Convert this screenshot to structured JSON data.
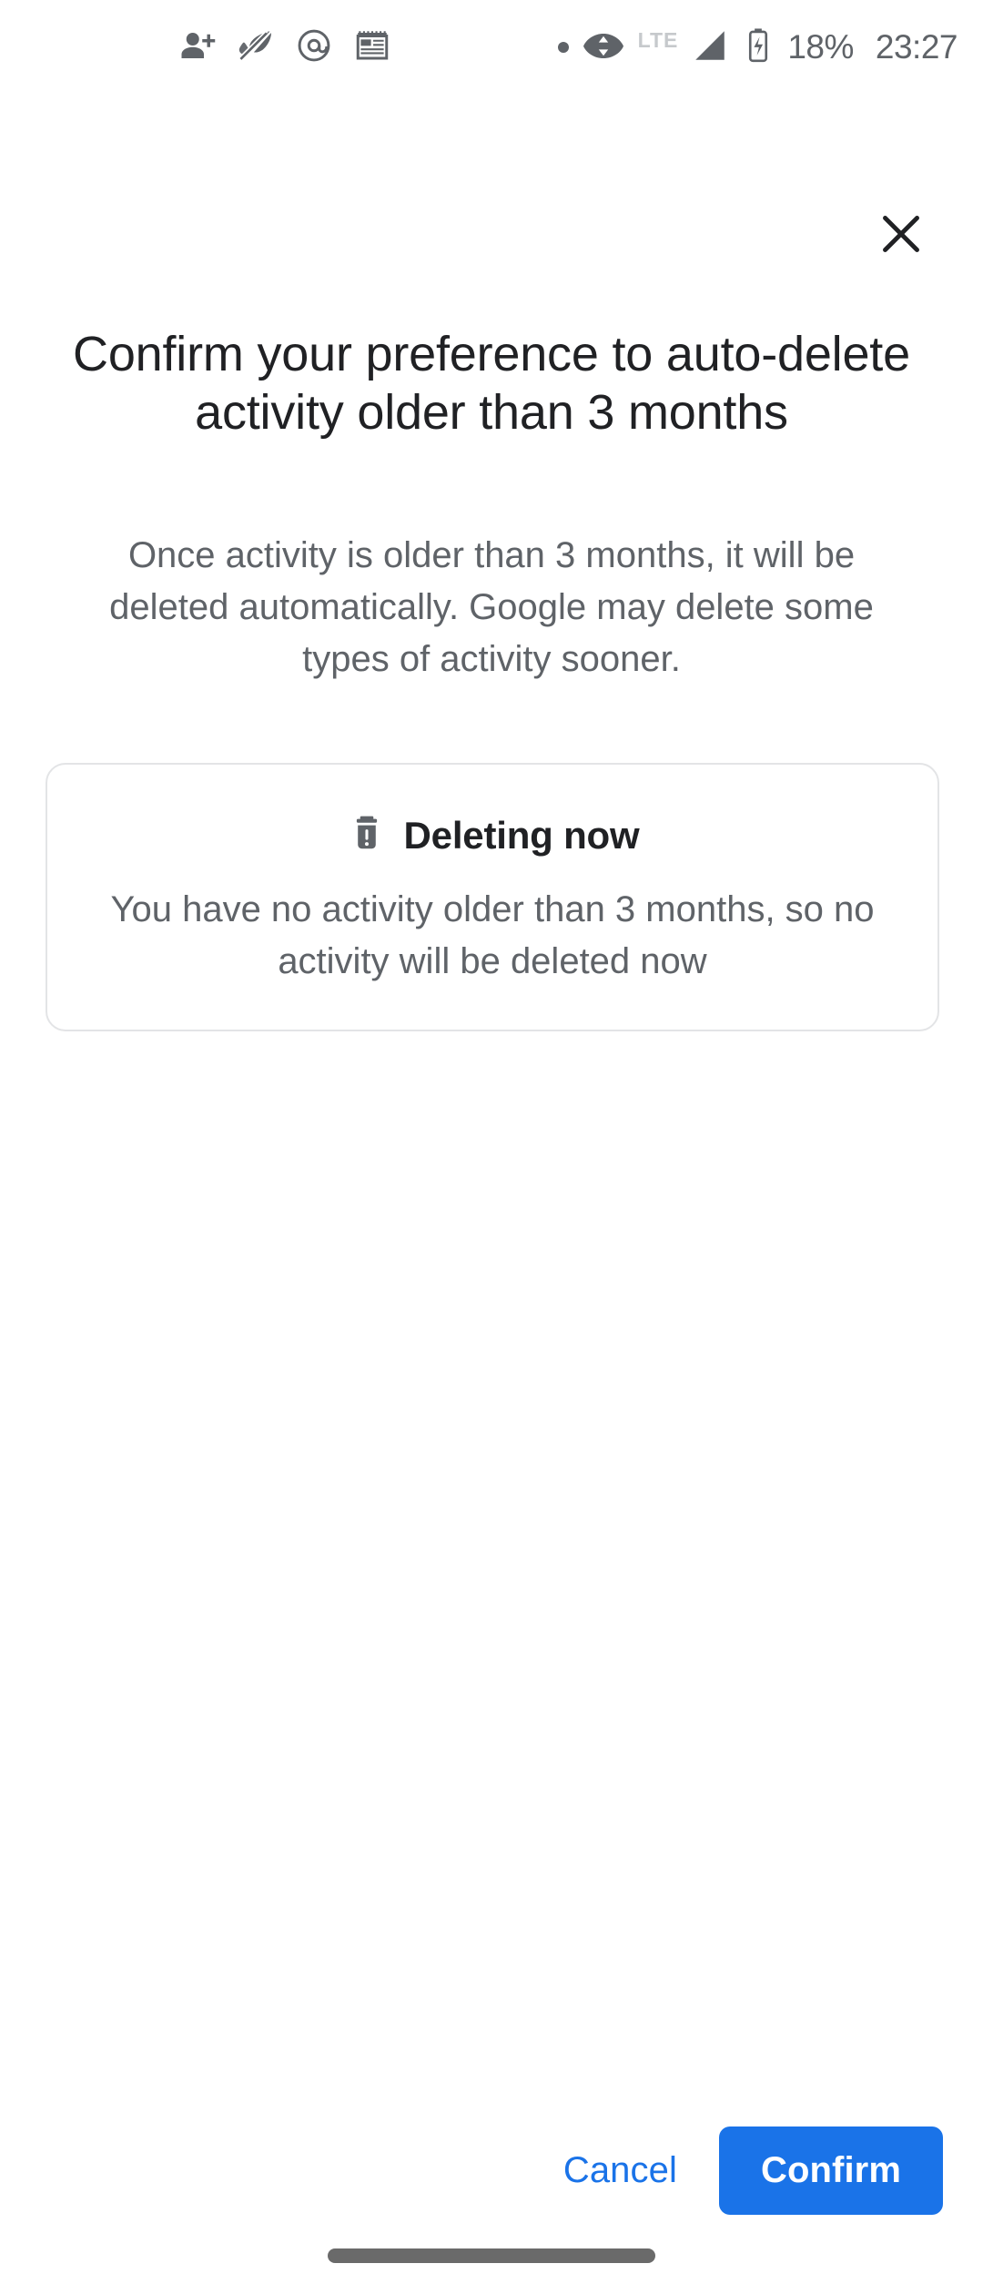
{
  "status_bar": {
    "icons_left": [
      {
        "name": "person-add-icon",
        "label": "person add"
      },
      {
        "name": "volume-off-icon",
        "label": "sound muted"
      },
      {
        "name": "at-sign-icon",
        "label": "mention"
      },
      {
        "name": "calendar-note-icon",
        "label": "calendar note"
      }
    ],
    "icons_right": [
      {
        "name": "small-dot-icon",
        "label": "dot"
      },
      {
        "name": "wifi-data-icon",
        "label": "wifi with data transfer"
      },
      {
        "name": "signal-bars-icon",
        "label": "cellular signal"
      },
      {
        "name": "battery-charging-icon",
        "label": "battery charging"
      }
    ],
    "network_type": "LTE",
    "battery_percent": "18%",
    "clock": "23:27"
  },
  "dialog": {
    "close_label": "Close",
    "close_icon": "close-icon",
    "title": "Confirm your preference to auto-delete activity older than 3 months",
    "description": "Once activity is older than 3 months, it will be deleted automatically. Google may delete some types of activity sooner.",
    "card": {
      "icon": "delete-alert-icon",
      "heading": "Deleting now",
      "body": "You have no activity older than 3 months, so no activity will be deleted now"
    },
    "actions": {
      "cancel_label": "Cancel",
      "confirm_label": "Confirm"
    }
  },
  "colors": {
    "accent_blue": "#1a73e8",
    "text_primary": "#202124",
    "text_secondary": "#5f6368",
    "card_border": "#e3e4e6",
    "background": "#ffffff"
  }
}
